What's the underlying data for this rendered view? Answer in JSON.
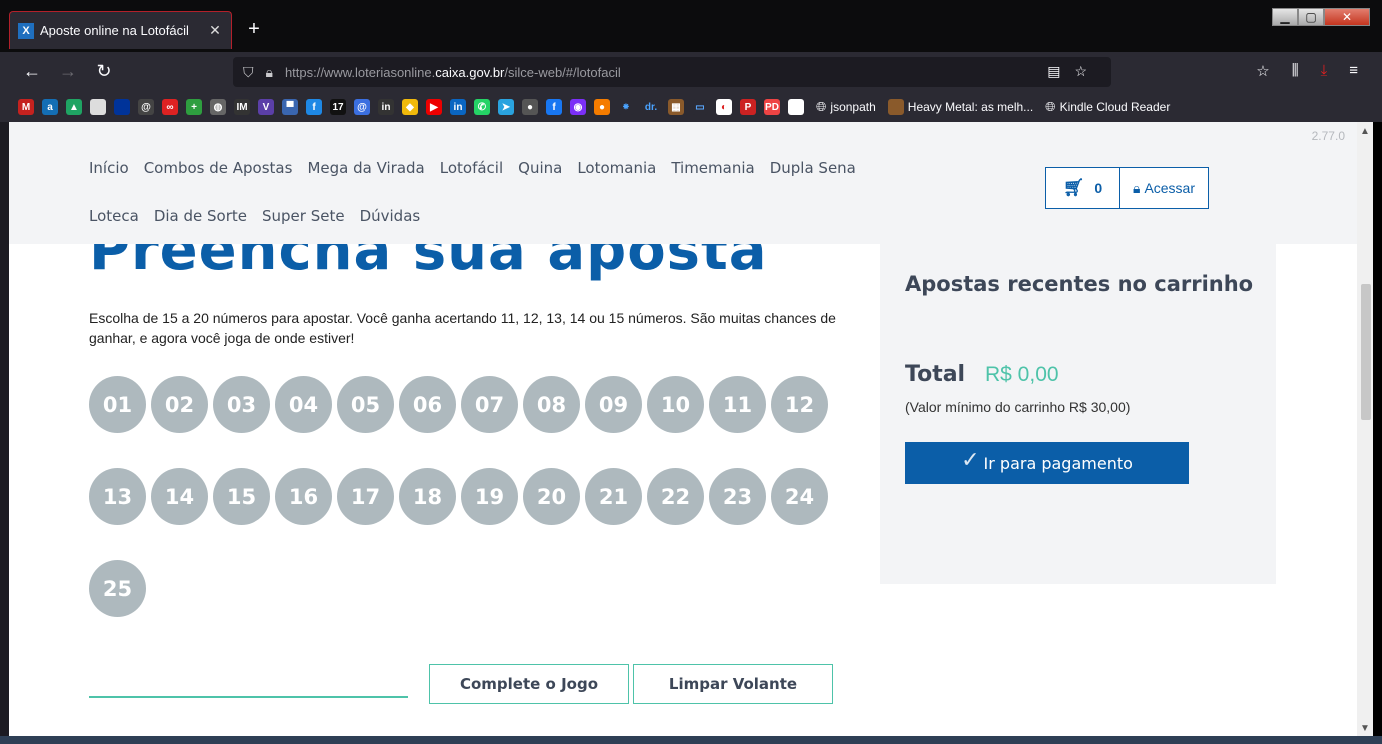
{
  "browser": {
    "tab": {
      "favicon": "X",
      "title": "Aposte online na Lotofácil"
    },
    "url_prefix": "https://www.loteriasonline.",
    "url_domain": "caixa.gov.br",
    "url_path": "/silce-web/#/lotofacil",
    "bookmarks_text": [
      "jsonpath",
      "Heavy Metal: as melh...",
      "Kindle Cloud Reader"
    ]
  },
  "header": {
    "version": "2.77.0",
    "menu_row1": [
      "Início",
      "Combos de Apostas",
      "Mega da Virada",
      "Lotofácil",
      "Quina",
      "Lotomania",
      "Timemania",
      "Dupla Sena"
    ],
    "menu_row2": [
      "Loteca",
      "Dia de Sorte",
      "Super Sete",
      "Dúvidas"
    ],
    "cart_count": "0",
    "access_label": "Acessar"
  },
  "main": {
    "headline": "Preencha sua aposta",
    "description": "Escolha de 15 a 20 números para apostar. Você ganha acertando 11, 12, 13, 14 ou 15 números. São muitas chances de ganhar, e agora você joga de onde estiver!",
    "numbers": [
      "01",
      "02",
      "03",
      "04",
      "05",
      "06",
      "07",
      "08",
      "09",
      "10",
      "11",
      "12",
      "13",
      "14",
      "15",
      "16",
      "17",
      "18",
      "19",
      "20",
      "21",
      "22",
      "23",
      "24",
      "25"
    ],
    "complete_label": "Complete o Jogo",
    "clear_label": "Limpar Volante"
  },
  "sidebar": {
    "title": "Apostas recentes no carrinho",
    "total_label": "Total",
    "total_value": "R$ 0,00",
    "min_note": "(Valor mínimo do carrinho R$ 30,00)",
    "pay_label": "Ir para pagamento"
  },
  "colors": {
    "primary": "#0b5ea8",
    "accent": "#4ec3a9",
    "ball": "#aeb9be",
    "header_bg": "#f3f4f6"
  }
}
